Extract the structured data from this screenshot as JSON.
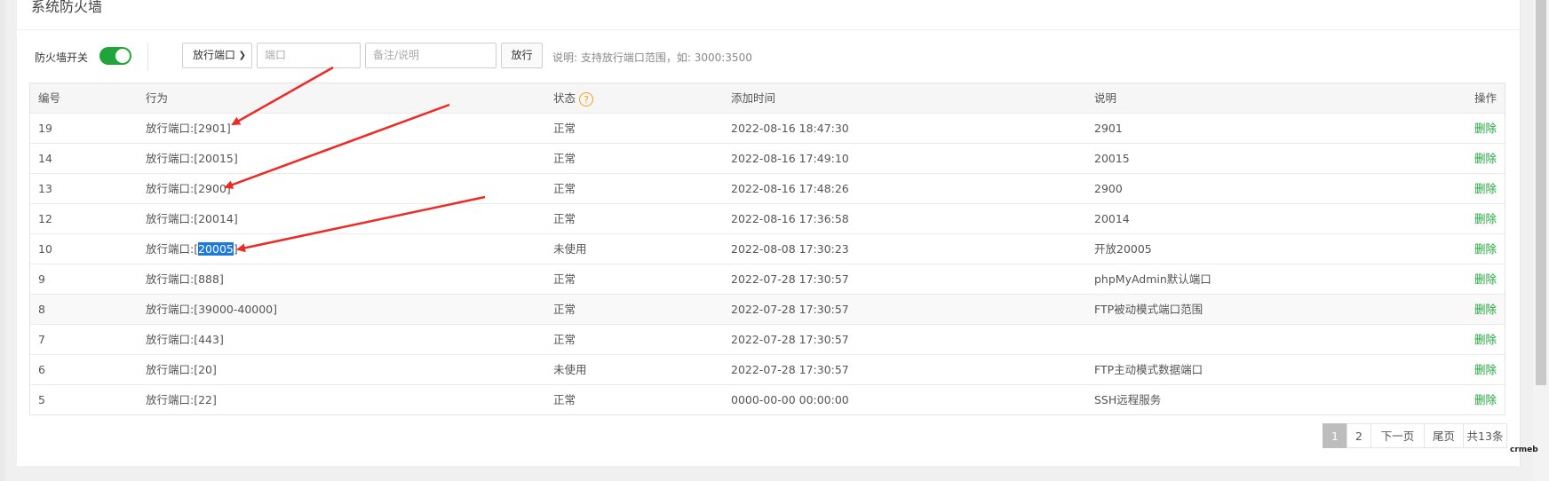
{
  "panel": {
    "title": "系统防火墙"
  },
  "toolbar": {
    "firewall_toggle_label": "防火墙开关",
    "toggle_on": true,
    "rule_type_selected": "放行端口",
    "port_placeholder": "端口",
    "note_placeholder": "备注/说明",
    "allow_button": "放行",
    "hint": "说明: 支持放行端口范围，如: 3000:3500"
  },
  "table": {
    "headers": {
      "id": "编号",
      "action": "行为",
      "status": "状态",
      "status_help": "?",
      "time": "添加时间",
      "desc": "说明",
      "op": "操作"
    },
    "rows": [
      {
        "id": "19",
        "action": "放行端口:[2901]",
        "status": "正常",
        "time": "2022-08-16 18:47:30",
        "desc": "2901",
        "op": "删除"
      },
      {
        "id": "14",
        "action": "放行端口:[20015]",
        "status": "正常",
        "time": "2022-08-16 17:49:10",
        "desc": "20015",
        "op": "删除"
      },
      {
        "id": "13",
        "action": "放行端口:[2900]",
        "status": "正常",
        "time": "2022-08-16 17:48:26",
        "desc": "2900",
        "op": "删除"
      },
      {
        "id": "12",
        "action": "放行端口:[20014]",
        "status": "正常",
        "time": "2022-08-16 17:36:58",
        "desc": "20014",
        "op": "删除"
      },
      {
        "id": "10",
        "action_prefix": "放行端口:[",
        "action_highlight": "20005",
        "action_suffix": "]",
        "status": "未使用",
        "time": "2022-08-08 17:30:23",
        "desc": "开放20005",
        "op": "删除"
      },
      {
        "id": "9",
        "action": "放行端口:[888]",
        "status": "正常",
        "time": "2022-07-28 17:30:57",
        "desc": "phpMyAdmin默认端口",
        "op": "删除"
      },
      {
        "id": "8",
        "action": "放行端口:[39000-40000]",
        "status": "正常",
        "time": "2022-07-28 17:30:57",
        "desc": "FTP被动模式端口范围",
        "op": "删除"
      },
      {
        "id": "7",
        "action": "放行端口:[443]",
        "status": "正常",
        "time": "2022-07-28 17:30:57",
        "desc": "",
        "op": "删除"
      },
      {
        "id": "6",
        "action": "放行端口:[20]",
        "status": "未使用",
        "time": "2022-07-28 17:30:57",
        "desc": "FTP主动模式数据端口",
        "op": "删除"
      },
      {
        "id": "5",
        "action": "放行端口:[22]",
        "status": "正常",
        "time": "0000-00-00 00:00:00",
        "desc": "SSH远程服务",
        "op": "删除"
      }
    ]
  },
  "pager": {
    "p1": "1",
    "p2": "2",
    "next": "下一页",
    "last": "尾页",
    "total": "共13条"
  },
  "watermark": "crmeb",
  "colors": {
    "accent": "#20a53a",
    "highlight": "#1e7ad8",
    "arrow": "#ee2a24",
    "warn": "#f0a020"
  }
}
